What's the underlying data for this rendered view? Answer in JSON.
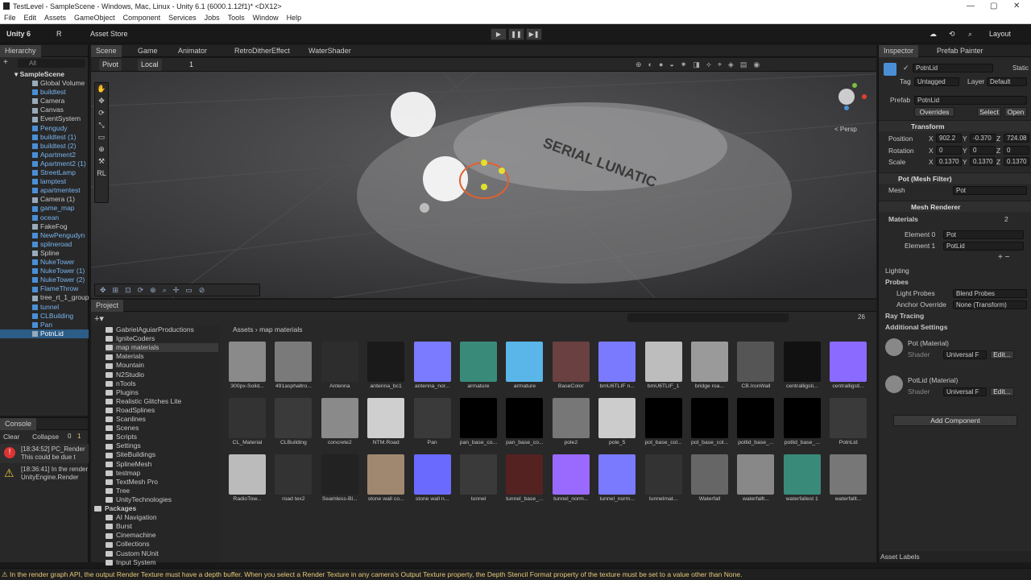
{
  "window": {
    "title": "TestLevel - SampleScene - Windows, Mac, Linux - Unity 6.1 (6000.1.12f1)* <DX12>",
    "controls": [
      "—",
      "▢",
      "✕"
    ]
  },
  "menu": [
    "File",
    "Edit",
    "Assets",
    "GameObject",
    "Component",
    "Services",
    "Jobs",
    "Tools",
    "Window",
    "Help"
  ],
  "toolbar": {
    "account": "Unity 6",
    "user": "R",
    "asset_store": "Asset Store",
    "layout": "Layout"
  },
  "hierarchy": {
    "tab": "Hierarchy",
    "search": "All",
    "root": "SampleScene",
    "items": [
      {
        "label": "Global Volume",
        "blue": false
      },
      {
        "label": "buildtest",
        "blue": true
      },
      {
        "label": "Camera",
        "blue": false
      },
      {
        "label": "Canvas",
        "blue": false
      },
      {
        "label": "EventSystem",
        "blue": false
      },
      {
        "label": "Pengudy",
        "blue": true
      },
      {
        "label": "buildtest (1)",
        "blue": true
      },
      {
        "label": "buildtest (2)",
        "blue": true
      },
      {
        "label": "Apartment2",
        "blue": true
      },
      {
        "label": "Apartment2 (1)",
        "blue": true
      },
      {
        "label": "StreetLamp",
        "blue": true
      },
      {
        "label": "lamptest",
        "blue": true
      },
      {
        "label": "apartmentest",
        "blue": true
      },
      {
        "label": "Camera (1)",
        "blue": false
      },
      {
        "label": "game_map",
        "blue": true
      },
      {
        "label": "ocean",
        "blue": true
      },
      {
        "label": "FakeFog",
        "blue": false
      },
      {
        "label": "NewPengudyn",
        "blue": true
      },
      {
        "label": "splineroad",
        "blue": true
      },
      {
        "label": "Spline",
        "blue": false
      },
      {
        "label": "NukeTower",
        "blue": true
      },
      {
        "label": "NukeTower (1)",
        "blue": true
      },
      {
        "label": "NukeTower (2)",
        "blue": true
      },
      {
        "label": "FlameThrow",
        "blue": true
      },
      {
        "label": "tree_rt_1_group",
        "blue": false
      },
      {
        "label": "tunnel",
        "blue": true
      },
      {
        "label": "CLBuilding",
        "blue": true
      },
      {
        "label": "Pan",
        "blue": true
      },
      {
        "label": "PotnLid",
        "blue": false
      }
    ]
  },
  "scene": {
    "tabs": [
      "Scene",
      "Game",
      "Animator",
      "RetroDitherEffect",
      "WaterShader"
    ],
    "pivot": "Pivot",
    "local": "Local",
    "snap": "1",
    "persp": "< Persp",
    "sign_text": "SERIAL LUNATIC"
  },
  "console": {
    "tab": "Console",
    "clear": "Clear",
    "collapse": "Collapse",
    "counts": [
      "0",
      "1"
    ],
    "entries": [
      {
        "time": "[18:34:52] PC_Render",
        "sub": "This could be due t",
        "type": "error"
      },
      {
        "time": "[18:36:41] In the render",
        "sub": "UnityEngine.Render",
        "type": "warning"
      }
    ]
  },
  "project": {
    "tab": "Project",
    "breadcrumb": [
      "Assets",
      "map materials"
    ],
    "count": "26",
    "folders": [
      {
        "label": "GabrielAguiarProductions",
        "indent": 1
      },
      {
        "label": "IgniteCoders",
        "indent": 1
      },
      {
        "label": "map materials",
        "indent": 1,
        "sel": true
      },
      {
        "label": "Materials",
        "indent": 1
      },
      {
        "label": "Mountain",
        "indent": 1
      },
      {
        "label": "N2Studio",
        "indent": 1
      },
      {
        "label": "nTools",
        "indent": 1
      },
      {
        "label": "Plugins",
        "indent": 1
      },
      {
        "label": "Realistic Glitches Lite",
        "indent": 1
      },
      {
        "label": "RoadSplines",
        "indent": 1
      },
      {
        "label": "Scanlines",
        "indent": 1
      },
      {
        "label": "Scenes",
        "indent": 1
      },
      {
        "label": "Scripts",
        "indent": 1
      },
      {
        "label": "Settings",
        "indent": 1
      },
      {
        "label": "SiteBuildings",
        "indent": 1
      },
      {
        "label": "SplineMesh",
        "indent": 1
      },
      {
        "label": "testmap",
        "indent": 1
      },
      {
        "label": "TextMesh Pro",
        "indent": 1
      },
      {
        "label": "Tree",
        "indent": 1
      },
      {
        "label": "UnityTechnologies",
        "indent": 1
      },
      {
        "label": "Packages",
        "indent": 0
      },
      {
        "label": "AI Navigation",
        "indent": 1
      },
      {
        "label": "Burst",
        "indent": 1
      },
      {
        "label": "Cinemachine",
        "indent": 1
      },
      {
        "label": "Collections",
        "indent": 1
      },
      {
        "label": "Custom NUnit",
        "indent": 1
      },
      {
        "label": "Input System",
        "indent": 1
      }
    ],
    "assets": [
      {
        "label": "300px-Solid...",
        "color": "#8a8a8a"
      },
      {
        "label": "491asphaltro...",
        "color": "#7a7a7a"
      },
      {
        "label": "Antenna",
        "color": "#2d2d2d"
      },
      {
        "label": "antenna_bc1",
        "color": "#1a1a1a"
      },
      {
        "label": "antenna_nor...",
        "color": "#7b7bff"
      },
      {
        "label": "armature",
        "color": "#3a8a7a"
      },
      {
        "label": "armature",
        "color": "#5ab6e8"
      },
      {
        "label": "BaseColor",
        "color": "#6a4040"
      },
      {
        "label": "bmU6TLIF n...",
        "color": "#7a7aff"
      },
      {
        "label": "bmU6TLIF_1",
        "color": "#bdbdbd"
      },
      {
        "label": "bridge roa...",
        "color": "#9a9a9a"
      },
      {
        "label": "CB.IronWall",
        "color": "#555555"
      },
      {
        "label": "centralligsti...",
        "color": "#111111"
      },
      {
        "label": "centralligsti...",
        "color": "#8a6aff"
      },
      {
        "label": "CL_Material",
        "color": "#333333"
      },
      {
        "label": "CLBuilding",
        "color": "#3a3a3a"
      },
      {
        "label": "concrete2",
        "color": "#8a8a8a"
      },
      {
        "label": "NTM.Road",
        "color": "#cfcfcf"
      },
      {
        "label": "Pan",
        "color": "#3a3a3a"
      },
      {
        "label": "pan_base_co...",
        "color": "#000000"
      },
      {
        "label": "pan_base_co...",
        "color": "#000000"
      },
      {
        "label": "pole2",
        "color": "#777777"
      },
      {
        "label": "pole_5",
        "color": "#cccccc"
      },
      {
        "label": "pot_base_col...",
        "color": "#000000"
      },
      {
        "label": "pot_base_col...",
        "color": "#000000"
      },
      {
        "label": "potlid_base_...",
        "color": "#000000"
      },
      {
        "label": "potlid_base_...",
        "color": "#000000"
      },
      {
        "label": "PotnLid",
        "color": "#3a3a3a"
      },
      {
        "label": "RadioTow...",
        "color": "#bbbbbb"
      },
      {
        "label": "road tex2",
        "color": "#333333"
      },
      {
        "label": "Seamless-Bl...",
        "color": "#222222"
      },
      {
        "label": "stone wall co...",
        "color": "#a08870"
      },
      {
        "label": "stone wall n...",
        "color": "#6a6aff"
      },
      {
        "label": "tunnel",
        "color": "#3a3a3a"
      },
      {
        "label": "tunnel_base_...",
        "color": "#552222"
      },
      {
        "label": "tunnel_norm...",
        "color": "#9a6aff"
      },
      {
        "label": "tunnel_norm...",
        "color": "#7a7aff"
      },
      {
        "label": "tunnelmat...",
        "color": "#333333"
      },
      {
        "label": "Waterfall",
        "color": "#666666"
      },
      {
        "label": "waterfallt...",
        "color": "#888888"
      },
      {
        "label": "waterfallest 1",
        "color": "#3a8a7a"
      },
      {
        "label": "waterfallt...",
        "color": "#777777"
      }
    ]
  },
  "inspector": {
    "tabs": [
      "Inspector",
      "Prefab Painter"
    ],
    "name": "PotnLid",
    "static": "Static",
    "tag_label": "Tag",
    "tag": "Untagged",
    "layer_label": "Layer",
    "layer": "Default",
    "prefab_label": "Prefab",
    "prefab": "PotnLid",
    "overrides": "Overrides",
    "select": "Select",
    "open": "Open",
    "transform": {
      "title": "Transform",
      "position": [
        "Position",
        "X",
        "902.2",
        "Y",
        "-0.370",
        "Z",
        "724.08"
      ],
      "rotation": [
        "Rotation",
        "X",
        "0",
        "Y",
        "0",
        "Z",
        "0"
      ],
      "scale": [
        "Scale",
        "X",
        "0.1370",
        "Y",
        "0.1370",
        "Z",
        "0.1370"
      ]
    },
    "mesh_filter": {
      "title": "Pot (Mesh Filter)",
      "mesh_label": "Mesh",
      "mesh": "Pot"
    },
    "mesh_renderer": {
      "title": "Mesh Renderer",
      "materials_label": "Materials",
      "materials_count": "2",
      "el0": "Element 0",
      "el0_val": "Pot",
      "el1": "Element 1",
      "el1_val": "PotLid"
    },
    "lighting": "Lighting",
    "probes": "Probes",
    "light_probes_label": "Light Probes",
    "light_probes": "Blend Probes",
    "anchor_label": "Anchor Override",
    "anchor": "None (Transform)",
    "ray_tracing": "Ray Tracing",
    "additional": "Additional Settings",
    "mat1": {
      "name": "Pot (Material)",
      "shader_label": "Shader",
      "shader": "Universal F",
      "edit": "Edit..."
    },
    "mat2": {
      "name": "PotLid (Material)",
      "shader_label": "Shader",
      "shader": "Universal F",
      "edit": "Edit..."
    },
    "add_component": "Add Component",
    "asset_labels": "Asset Labels"
  },
  "status": "In the render graph API, the output Render Texture must have a depth buffer. When you select a Render Texture in any camera's Output Texture property, the Depth Stencil Format property of the texture must be set to a value other than None."
}
